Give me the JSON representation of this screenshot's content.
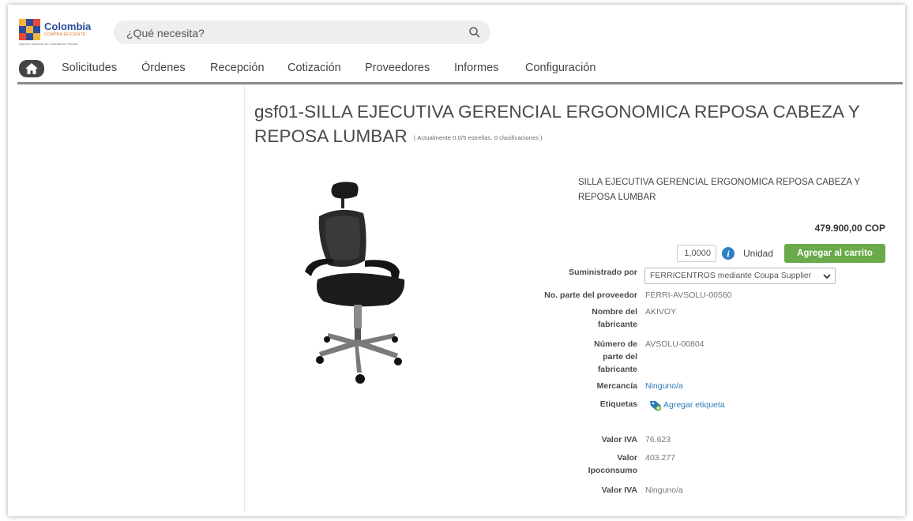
{
  "header": {
    "logo": {
      "title": "Colombia",
      "subtitle": "COMPRA EFICIENTE",
      "footer": "Agencia Nacional de Contratación Pública"
    },
    "search": {
      "placeholder": "¿Qué necesita?",
      "icon": "search-icon"
    }
  },
  "nav": {
    "home_icon": "home-icon",
    "items": [
      "Solicitudes",
      "Órdenes",
      "Recepción",
      "Cotización",
      "Proveedores",
      "Informes",
      "Configuración"
    ]
  },
  "product": {
    "title": "gsf01-SILLA EJECUTIVA GERENCIAL ERGONOMICA REPOSA CABEZA Y REPOSA LUMBAR",
    "rating_text": "( Actualmente 0.0/5 estrellas. 0 clasificaciones )",
    "rating_value": 0.0,
    "description": "SILLA EJECUTIVA GERENCIAL ERGONOMICA REPOSA CABEZA Y REPOSA LUMBAR",
    "price": "479.900,00 COP",
    "quantity": "1,0000",
    "unit": "Unidad",
    "add_to_cart": "Agregar al carrito"
  },
  "details": {
    "supplied_by_label": "Suministrado por",
    "supplied_by_value": "FERRICENTROS mediante Coupa Supplier",
    "supplier_part_label": "No. parte del proveedor",
    "supplier_part_value": "FERRI-AVSOLU-00560",
    "manufacturer_label": "Nombre del fabricante",
    "manufacturer_value": "AKIVOY",
    "manufacturer_part_label": "Número de parte del fabricante",
    "manufacturer_part_value": "AVSOLU-00804",
    "commodity_label": "Mercancía",
    "commodity_value": "Ninguno/a",
    "tags_label": "Etiquetas",
    "tags_value": "Agregar etiqueta",
    "iva_label": "Valor IVA",
    "iva_value": "76.623",
    "ipoconsumo_label": "Valor Ipoconsumo",
    "ipoconsumo_value": "403.277",
    "iva2_label": "Valor IVA",
    "iva2_value": "Ninguno/a"
  },
  "colors": {
    "cart_button": "#6aaa4a",
    "link": "#2a7ab9",
    "info_icon": "#2f7fc1"
  }
}
